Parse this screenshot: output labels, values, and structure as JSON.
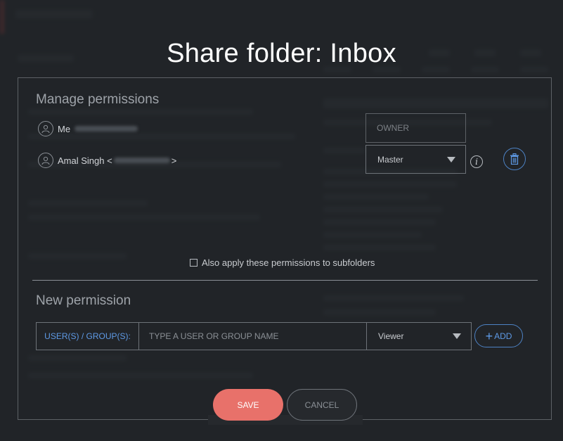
{
  "dialog": {
    "title": "Share folder: Inbox"
  },
  "manage": {
    "heading": "Manage permissions",
    "users": [
      {
        "name": "Me",
        "role": "OWNER"
      },
      {
        "name": "Amal Singh <",
        "name_suffix": ">",
        "role": "Master"
      }
    ],
    "subfolders_label": "Also apply these permissions to subfolders"
  },
  "new_permission": {
    "heading": "New permission",
    "label": "USER(S) / GROUP(S):",
    "placeholder": "TYPE A USER OR GROUP NAME",
    "role": "Viewer",
    "add_label": "ADD"
  },
  "actions": {
    "save": "SAVE",
    "cancel": "CANCEL"
  },
  "colors": {
    "accent_blue": "#5e9ae6",
    "save_button": "#e8716a"
  }
}
